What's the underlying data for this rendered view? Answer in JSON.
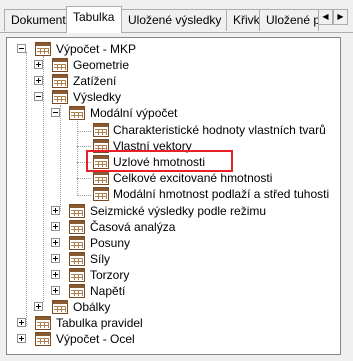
{
  "tabs": [
    {
      "label": "Dokument",
      "active": false
    },
    {
      "label": "Tabulka",
      "active": true
    },
    {
      "label": "Uložené výsledky",
      "active": false
    },
    {
      "label": "Křivky",
      "active": false
    },
    {
      "label": "Uložené po",
      "active": false
    }
  ],
  "scroll": {
    "left_icon": "◀",
    "right_icon": "▶"
  },
  "tree": [
    {
      "label": "Výpočet - MKP",
      "expander": "minus"
    },
    {
      "label": "Geometrie",
      "expander": "plus"
    },
    {
      "label": "Zatížení",
      "expander": "plus"
    },
    {
      "label": "Výsledky",
      "expander": "minus"
    },
    {
      "label": "Modální výpočet",
      "expander": "minus"
    },
    {
      "label": "Charakteristické hodnoty vlastních tvarů",
      "expander": "none"
    },
    {
      "label": "Vlastní vektory",
      "expander": "none"
    },
    {
      "label": "Uzlové hmotnosti",
      "expander": "none",
      "highlighted": true
    },
    {
      "label": "Celkové excitované hmotnosti",
      "expander": "none"
    },
    {
      "label": "Modální hmotnost podlaží a střed tuhosti",
      "expander": "none"
    },
    {
      "label": "Seizmické výsledky podle režimu",
      "expander": "plus"
    },
    {
      "label": "Časová analýza",
      "expander": "plus"
    },
    {
      "label": "Posuny",
      "expander": "plus"
    },
    {
      "label": "Síly",
      "expander": "plus"
    },
    {
      "label": "Torzory",
      "expander": "plus"
    },
    {
      "label": "Napětí",
      "expander": "plus"
    },
    {
      "label": "Obálky",
      "expander": "plus"
    },
    {
      "label": "Tabulka pravidel",
      "expander": "plus"
    },
    {
      "label": "Výpočet - Ocel",
      "expander": "plus"
    }
  ],
  "colors": {
    "highlight_border": "#e8202a",
    "icon": "#8a5a32"
  }
}
